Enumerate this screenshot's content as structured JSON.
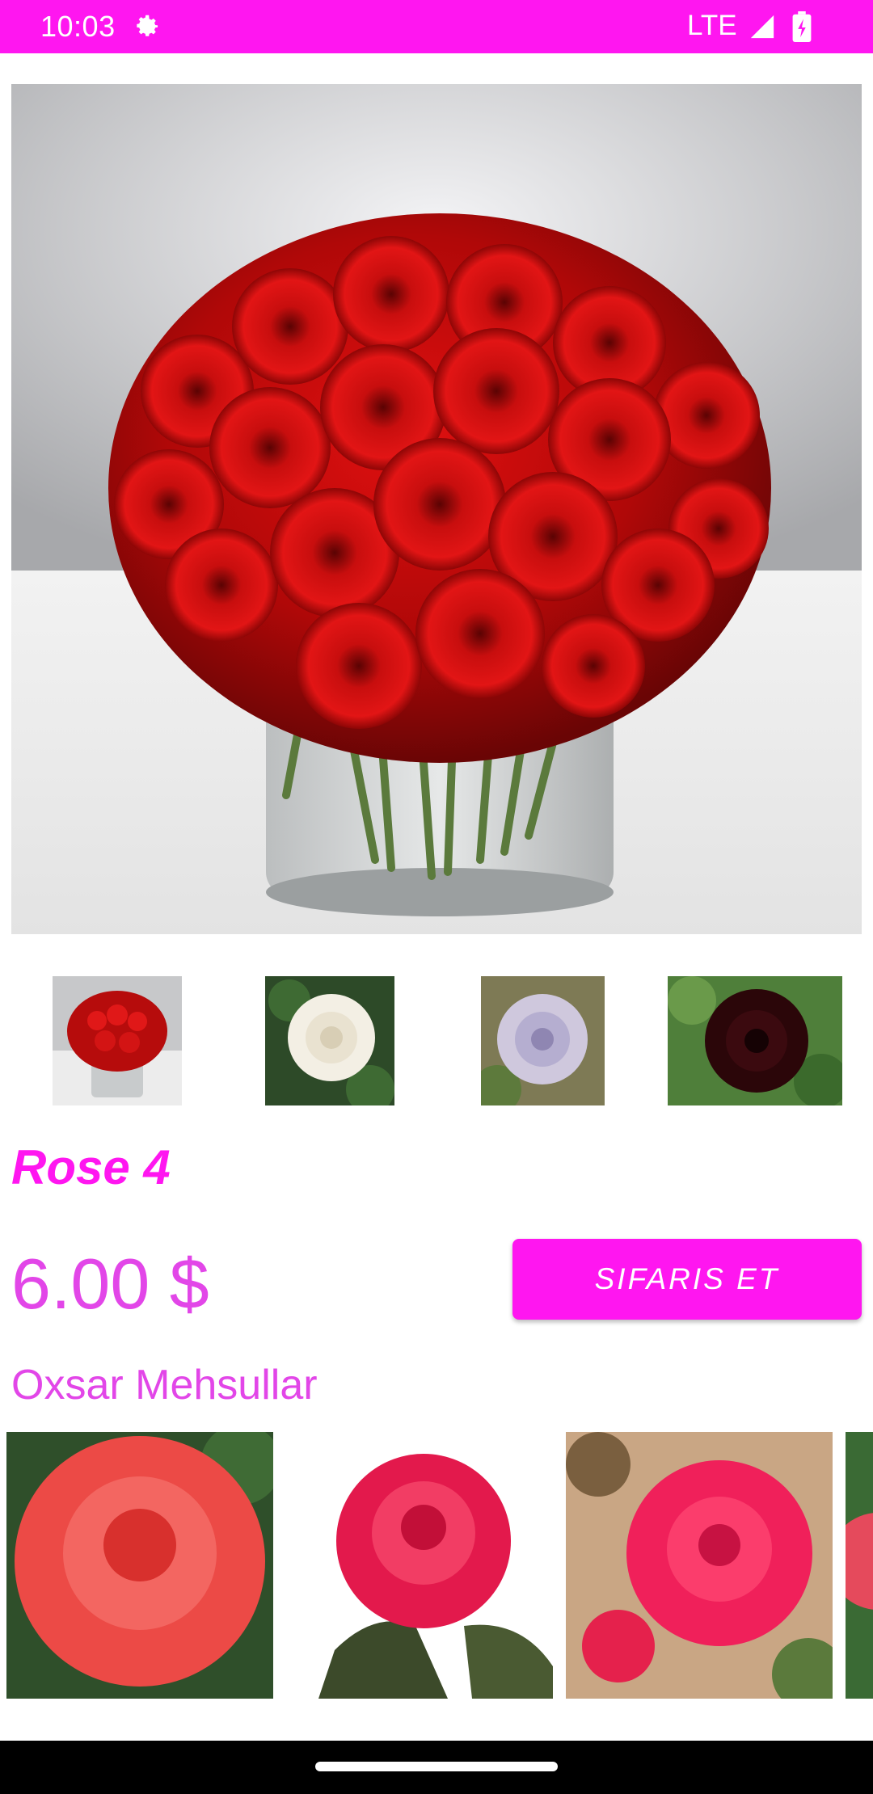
{
  "status_bar": {
    "time": "10:03",
    "network": "LTE",
    "gear_icon": "gear-icon",
    "signal_icon": "signal-icon",
    "battery_icon": "battery-charging-icon",
    "background": "#ff16f0"
  },
  "product": {
    "image_icon": "red-roses-bouquet-image",
    "thumbnails": [
      {
        "icon": "red-roses-bouquet-thumbnail"
      },
      {
        "icon": "white-rose-thumbnail"
      },
      {
        "icon": "lavender-rose-thumbnail"
      },
      {
        "icon": "black-rose-thumbnail"
      }
    ],
    "title": "Rose 4",
    "price": "6.00 $",
    "order_button_label": "SIFARIS ET"
  },
  "similar": {
    "heading": "Oxsar Mehsullar",
    "items": [
      {
        "icon": "coral-rose-image"
      },
      {
        "icon": "pink-rose-image"
      },
      {
        "icon": "pink-rose-garden-image"
      },
      {
        "icon": "partial-rose-image"
      }
    ]
  },
  "colors": {
    "accent": "#ff16f0",
    "text_accent": "#e246e8",
    "nav_bar": "#000000"
  }
}
